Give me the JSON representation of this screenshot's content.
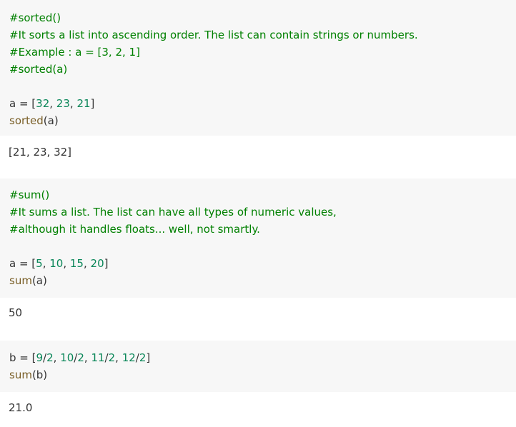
{
  "colors": {
    "comment": "#008000",
    "number": "#098658",
    "function": "#795e26",
    "text": "#333333",
    "cell_bg": "#f7f7f7"
  },
  "cells": [
    {
      "code": [
        [
          {
            "t": "#sorted()",
            "c": "c"
          }
        ],
        [
          {
            "t": "#It sorts a list into ascending order. The list can contain strings or numbers.",
            "c": "c"
          }
        ],
        [
          {
            "t": "#Example : a = [3, 2, 1]",
            "c": "c"
          }
        ],
        [
          {
            "t": "#sorted(a)",
            "c": "c"
          }
        ],
        [],
        [
          {
            "t": "a = [",
            "c": "p"
          },
          {
            "t": "32",
            "c": "n"
          },
          {
            "t": ", ",
            "c": "p"
          },
          {
            "t": "23",
            "c": "n"
          },
          {
            "t": ", ",
            "c": "p"
          },
          {
            "t": "21",
            "c": "n"
          },
          {
            "t": "]",
            "c": "p"
          }
        ],
        [
          {
            "t": "sorted",
            "c": "f"
          },
          {
            "t": "(a)",
            "c": "p"
          }
        ]
      ],
      "output": "[21, 23, 32]"
    },
    {
      "code": [
        [
          {
            "t": "#sum()",
            "c": "c"
          }
        ],
        [
          {
            "t": "#It sums a list. The list can have all types of numeric values,",
            "c": "c"
          }
        ],
        [
          {
            "t": "#although it handles floats... well, not smartly.",
            "c": "c"
          }
        ],
        [],
        [
          {
            "t": "a = [",
            "c": "p"
          },
          {
            "t": "5",
            "c": "n"
          },
          {
            "t": ", ",
            "c": "p"
          },
          {
            "t": "10",
            "c": "n"
          },
          {
            "t": ", ",
            "c": "p"
          },
          {
            "t": "15",
            "c": "n"
          },
          {
            "t": ", ",
            "c": "p"
          },
          {
            "t": "20",
            "c": "n"
          },
          {
            "t": "]",
            "c": "p"
          }
        ],
        [
          {
            "t": "sum",
            "c": "f"
          },
          {
            "t": "(a)",
            "c": "p"
          }
        ]
      ],
      "output": "50"
    },
    {
      "code": [
        [
          {
            "t": "b = [",
            "c": "p"
          },
          {
            "t": "9",
            "c": "n"
          },
          {
            "t": "/",
            "c": "p"
          },
          {
            "t": "2",
            "c": "n"
          },
          {
            "t": ", ",
            "c": "p"
          },
          {
            "t": "10",
            "c": "n"
          },
          {
            "t": "/",
            "c": "p"
          },
          {
            "t": "2",
            "c": "n"
          },
          {
            "t": ", ",
            "c": "p"
          },
          {
            "t": "11",
            "c": "n"
          },
          {
            "t": "/",
            "c": "p"
          },
          {
            "t": "2",
            "c": "n"
          },
          {
            "t": ", ",
            "c": "p"
          },
          {
            "t": "12",
            "c": "n"
          },
          {
            "t": "/",
            "c": "p"
          },
          {
            "t": "2",
            "c": "n"
          },
          {
            "t": "]",
            "c": "p"
          }
        ],
        [
          {
            "t": "sum",
            "c": "f"
          },
          {
            "t": "(b)",
            "c": "p"
          }
        ]
      ],
      "output": "21.0"
    }
  ]
}
